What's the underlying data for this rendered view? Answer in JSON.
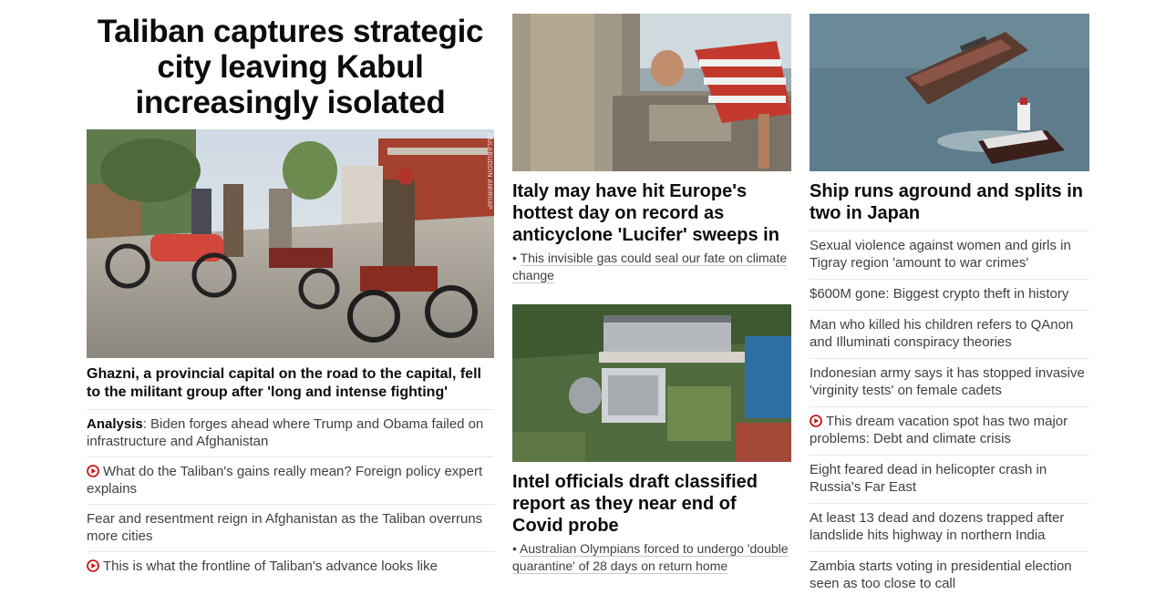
{
  "lead": {
    "headline": "Taliban captures strategic city leaving Kabul increasingly isolated",
    "image_credit": "GULABUDDIN AMIRI/AP",
    "caption": "Ghazni, a provincial capital on the road to the capital, fell to the militant group after 'long and intense fighting'",
    "items": [
      {
        "kicker": "Analysis",
        "text": ": Biden forges ahead where Trump and Obama failed on infrastructure and Afghanistan",
        "video": false
      },
      {
        "kicker": "",
        "text": "What do the Taliban's gains really mean? Foreign policy expert explains",
        "video": true
      },
      {
        "kicker": "",
        "text": "Fear and resentment reign in Afghanistan as the Taliban overruns more cities",
        "video": false
      },
      {
        "kicker": "",
        "text": "This is what the frontline of Taliban's advance looks like",
        "video": true
      }
    ]
  },
  "middle": {
    "card1": {
      "headline": "Italy may have hit Europe's hottest day on record as anticyclone 'Lucifer' sweeps in",
      "related": "This invisible gas could seal our fate on climate change"
    },
    "card2": {
      "headline": "Intel officials draft classified report as they near end of Covid probe",
      "related": "Australian Olympians forced to undergo 'double quarantine' of 28 days on return home"
    }
  },
  "right": {
    "headline": "Ship runs aground and splits in two in Japan",
    "items": [
      {
        "text": "Sexual violence against women and girls in Tigray region 'amount to war crimes'",
        "video": false
      },
      {
        "text": "$600M gone: Biggest crypto theft in history",
        "video": false
      },
      {
        "text": "Man who killed his children refers to QAnon and Illuminati conspiracy theories",
        "video": false
      },
      {
        "text": "Indonesian army says it has stopped invasive 'virginity tests' on female cadets",
        "video": false
      },
      {
        "text": "This dream vacation spot has two major problems: Debt and climate crisis",
        "video": true
      },
      {
        "text": "Eight feared dead in helicopter crash in Russia's Far East",
        "video": false
      },
      {
        "text": "At least 13 dead and dozens trapped after landslide hits highway in northern India",
        "video": false
      },
      {
        "text": "Zambia starts voting in presidential election seen as too close to call",
        "video": false
      }
    ]
  },
  "colors": {
    "video_red": "#cc0000",
    "text": "#0c0c0c",
    "muted": "#404040",
    "divider": "#e6e6e6"
  }
}
